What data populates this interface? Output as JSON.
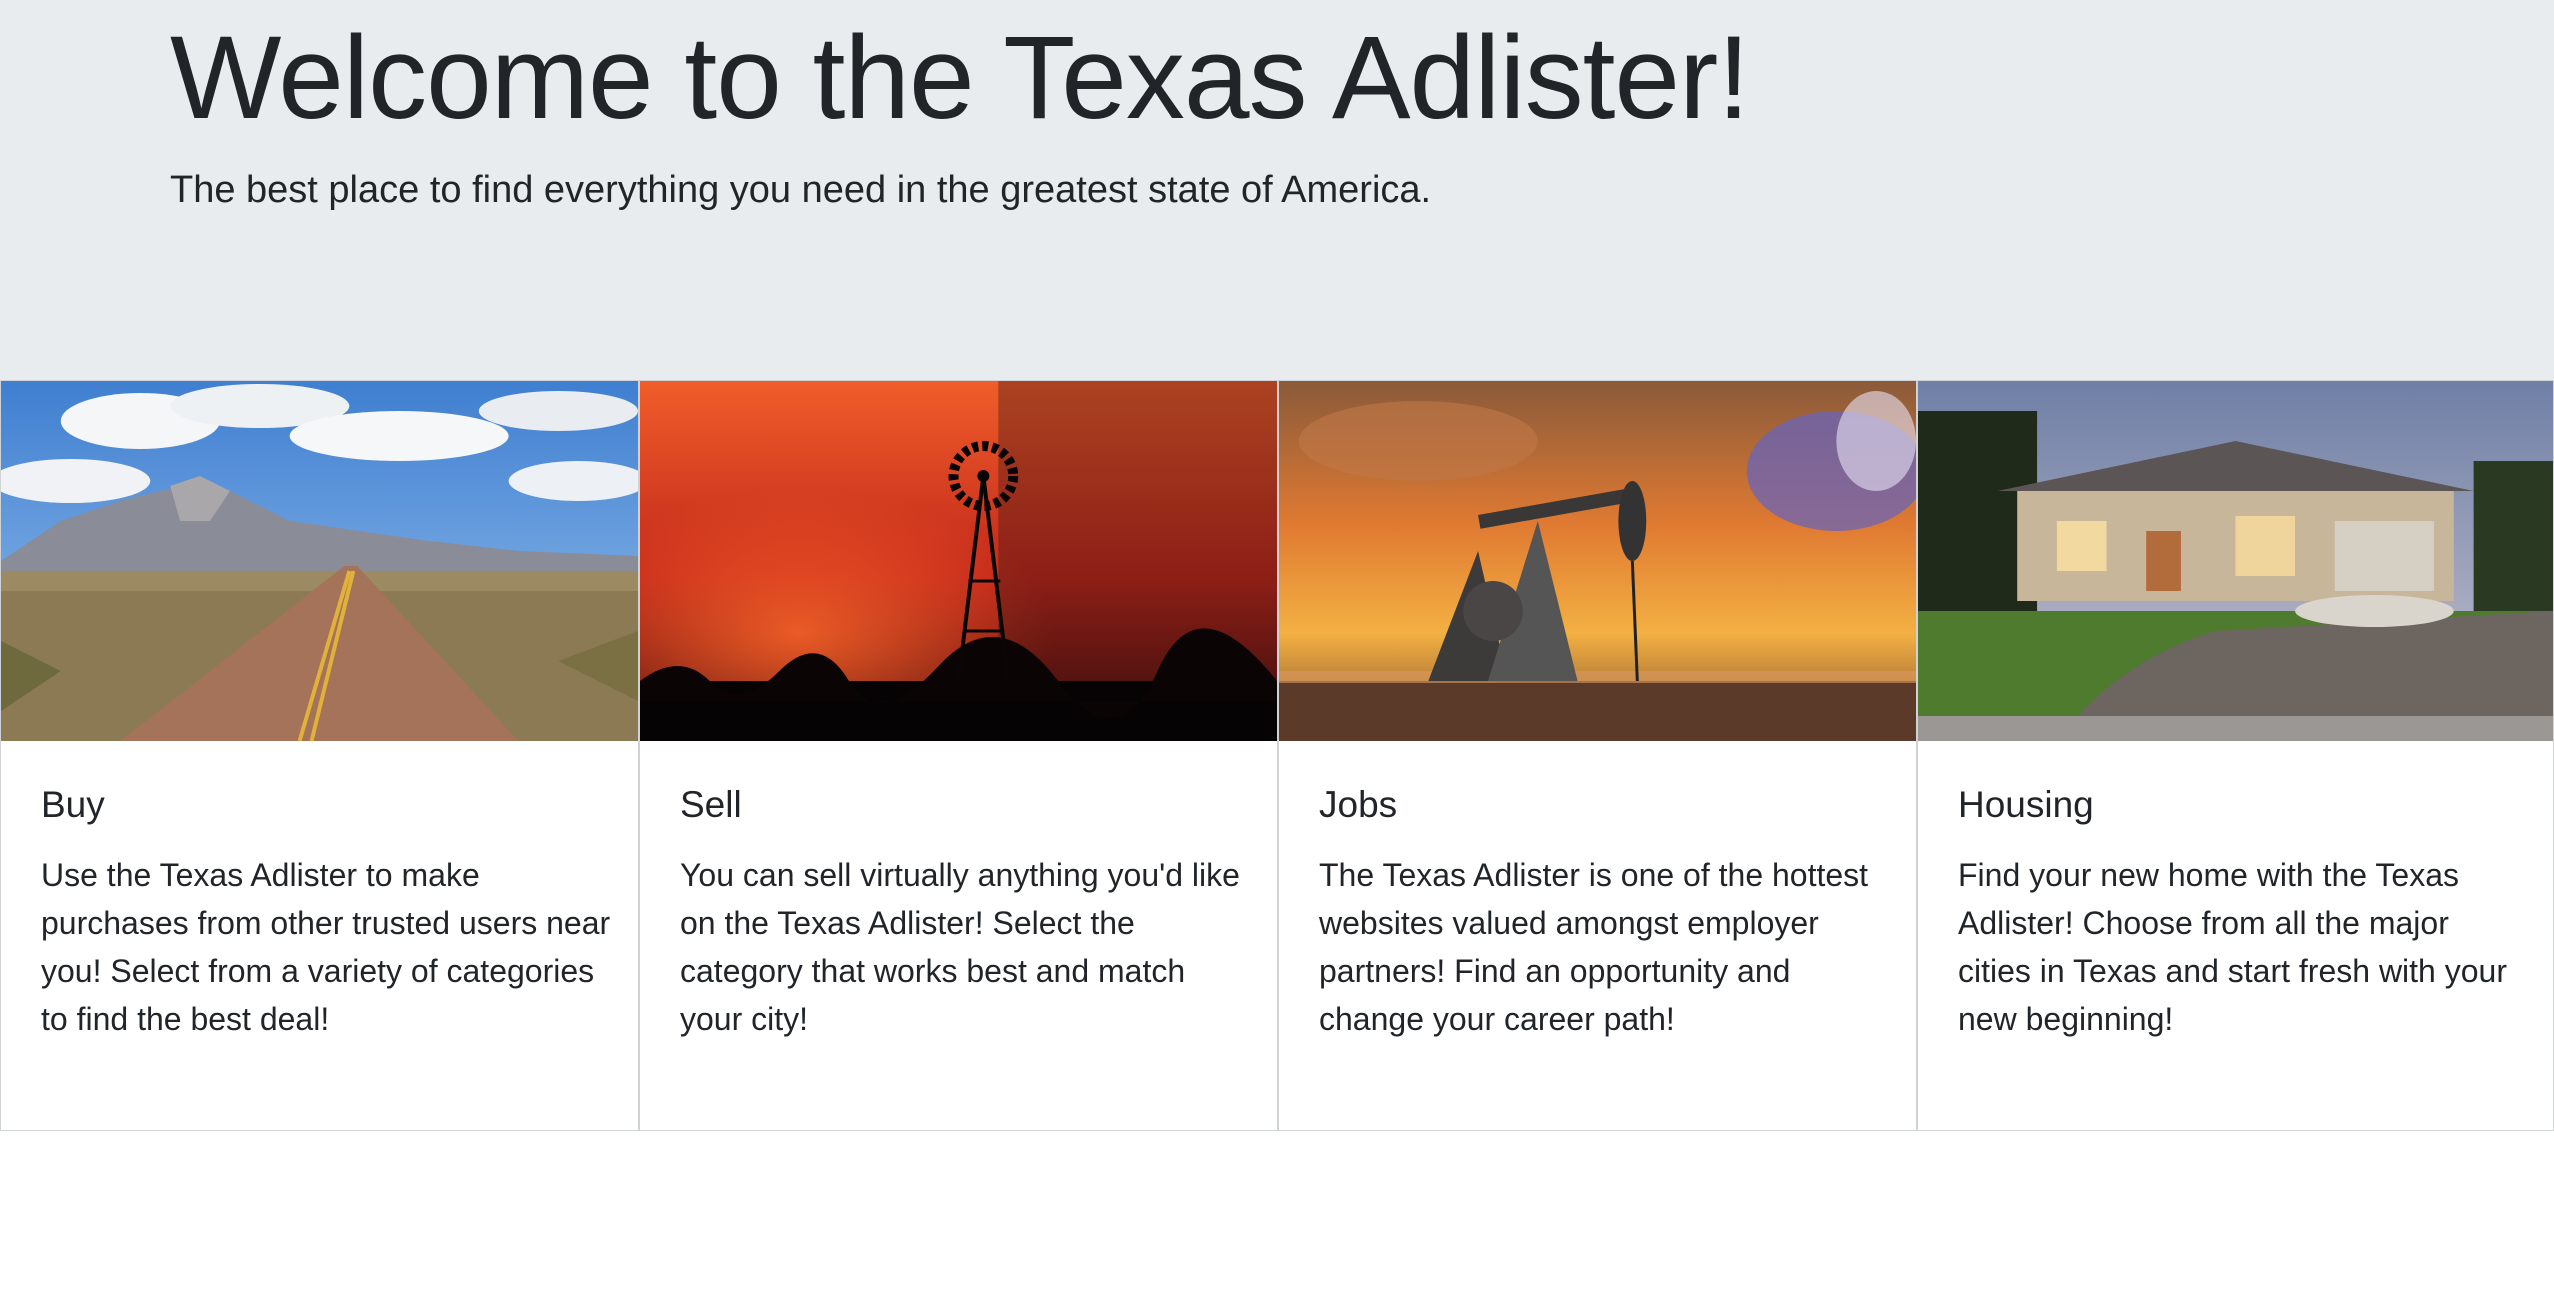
{
  "jumbotron": {
    "title": "Welcome to the Texas Adlister!",
    "lead": "The best place to find everything you need in the greatest state of America."
  },
  "cards": [
    {
      "title": "Buy",
      "text": "Use the Texas Adlister to make purchases from other trusted users near you! Select from a variety of categories to find the best deal!",
      "image": "desert-road-mountain-photo"
    },
    {
      "title": "Sell",
      "text": "You can sell virtually anything you'd like on the Texas Adlister! Select the category that works best and match your city!",
      "image": "windmill-sunset-photo"
    },
    {
      "title": "Jobs",
      "text": "The Texas Adlister is one of the hottest websites valued amongst employer partners! Find an opportunity and change your career path!",
      "image": "oil-pumpjack-sunset-photo"
    },
    {
      "title": "Housing",
      "text": "Find your new home with the Texas Adlister! Choose from all the major cities in Texas and start fresh with your new beginning!",
      "image": "suburban-house-photo"
    }
  ],
  "colors": {
    "jumbotron_bg": "#e9ecef",
    "text": "#212529",
    "card_border": "#d0d3d6"
  }
}
